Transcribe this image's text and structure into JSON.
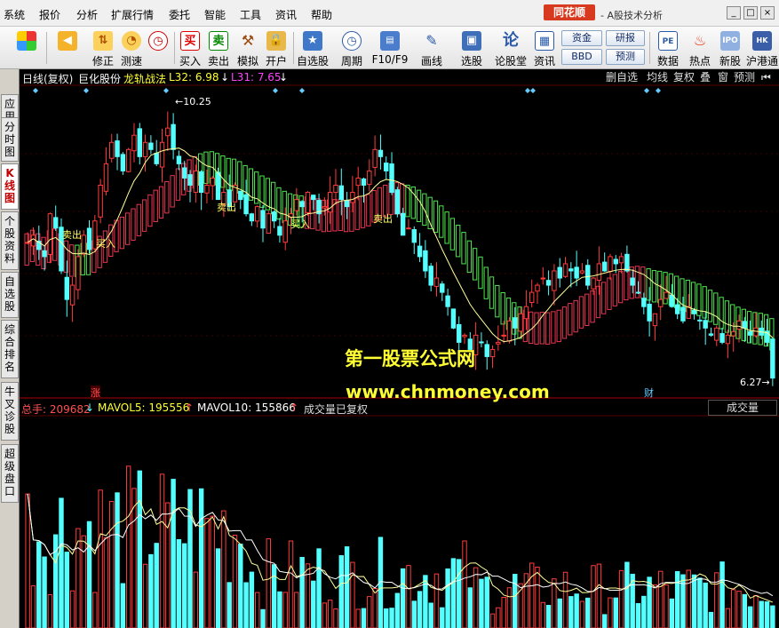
{
  "menu": [
    "系统",
    "报价",
    "分析",
    "扩展行情",
    "委托",
    "智能",
    "工具",
    "资讯",
    "帮助"
  ],
  "brand": {
    "logo": "同花顺",
    "title": "- A股技术分析"
  },
  "toolbar": {
    "buttons": [
      {
        "label": "",
        "icon": "grid-icon"
      },
      {
        "label": "",
        "icon": "back-arrow-icon"
      },
      {
        "label": "修正",
        "icon": "up-down-arrows-icon"
      },
      {
        "label": "测速",
        "icon": "speed-clock-icon"
      },
      {
        "label": "买入",
        "icon": "buy-icon",
        "glyph": "买"
      },
      {
        "label": "卖出",
        "icon": "sell-icon",
        "glyph": "卖"
      },
      {
        "label": "模拟",
        "icon": "hammer-icon"
      },
      {
        "label": "开户",
        "icon": "lock-icon"
      },
      {
        "label": "自选股",
        "icon": "star-icon"
      },
      {
        "label": "周期",
        "icon": "clock-icon"
      },
      {
        "label": "F10/F9",
        "icon": "f10-icon"
      },
      {
        "label": "画线",
        "icon": "pencil-icon"
      },
      {
        "label": "选股",
        "icon": "screen-icon"
      },
      {
        "label": "论股堂",
        "icon": "discuss-icon",
        "glyph": "论"
      },
      {
        "label": "资讯",
        "icon": "news-icon"
      },
      {
        "label": "数据",
        "icon": "data-icon"
      },
      {
        "label": "热点",
        "icon": "hot-icon"
      },
      {
        "label": "新股",
        "icon": "ipo-icon"
      },
      {
        "label": "沪港通",
        "icon": "sse-hkex-icon"
      }
    ],
    "small_buttons": [
      "资金",
      "BBD",
      "研报",
      "预测"
    ]
  },
  "left_tabs": [
    "应用",
    "分时图",
    "K线图",
    "个股资料",
    "自选股",
    "综合排名",
    "牛叉诊股",
    "超级盘口"
  ],
  "chart": {
    "period_label": "日线(复权)",
    "stock_name": "巨化股份",
    "indicator_name": "龙轨战法",
    "l32_label": "L32: 6.98",
    "l31_label": "L31: 7.65",
    "right_buttons": [
      "删自选",
      "均线",
      "复权",
      "叠",
      "窗",
      "预测"
    ],
    "high_label": "10.25",
    "low_label": "6.27",
    "buy_labels": [
      "买入",
      "买入",
      "买入"
    ],
    "sell_labels": [
      "卖出",
      "卖出",
      "卖出"
    ],
    "zhang_marker": "涨",
    "cai_marker": "财",
    "volume": {
      "total_label": "总手: 209682",
      "mavol5_label": "MAVOL5: 195556",
      "mavol10_label": "MAVOL10: 155866",
      "note": "成交量已复权",
      "panel_button": "成交量"
    },
    "watermark": {
      "line1": "第一股票公式网",
      "line2": "www.chnmoney.com"
    }
  },
  "colors": {
    "up": "#ff3c3c",
    "down": "#54ffff",
    "band_up": "#ff3c5a",
    "band_down": "#58ff58",
    "ma": "#ffff99",
    "text_yellow": "#ffff33",
    "text_magenta": "#ff44ff"
  },
  "chart_data": {
    "type": "candlestick",
    "price_range": [
      6.27,
      10.25
    ],
    "price_path": [
      8.2,
      8.3,
      8.1,
      8.0,
      8.6,
      8.4,
      7.8,
      7.4,
      7.6,
      8.0,
      8.3,
      8.1,
      8.5,
      9.0,
      9.3,
      9.6,
      9.4,
      9.2,
      9.5,
      9.7,
      9.4,
      9.6,
      9.5,
      9.3,
      9.6,
      9.8,
      9.5,
      9.3,
      9.1,
      9.0,
      9.2,
      8.9,
      9.0,
      9.1,
      8.8,
      8.9,
      8.7,
      9.0,
      8.8,
      8.6,
      8.5,
      8.7,
      8.4,
      8.6,
      8.5,
      8.3,
      8.5,
      8.6,
      8.8,
      8.7,
      8.9,
      8.8,
      8.6,
      8.7,
      8.9,
      9.0,
      8.8,
      8.7,
      8.9,
      9.1,
      9.0,
      9.2,
      9.5,
      9.4,
      9.2,
      8.9,
      8.6,
      8.3,
      8.4,
      8.2,
      8.0,
      7.8,
      7.6,
      7.7,
      7.5,
      7.3,
      7.0,
      6.8,
      6.9,
      6.7,
      6.9,
      6.8,
      6.6,
      6.7,
      6.8,
      6.9,
      7.1,
      7.0,
      7.2,
      7.3,
      7.5,
      7.6,
      7.7,
      7.6,
      7.8,
      7.7,
      7.9,
      7.8,
      7.7,
      7.8,
      7.6,
      7.7,
      7.9,
      7.8,
      8.0,
      7.9,
      8.0,
      7.8,
      7.6,
      7.5,
      7.3,
      7.1,
      7.2,
      7.4,
      7.5,
      7.3,
      7.2,
      7.1,
      7.3,
      7.2,
      7.1,
      7.0,
      6.9,
      7.0,
      6.8,
      6.9,
      6.95,
      7.1,
      7.0,
      6.9,
      7.0,
      6.9,
      6.8,
      6.3
    ]
  }
}
